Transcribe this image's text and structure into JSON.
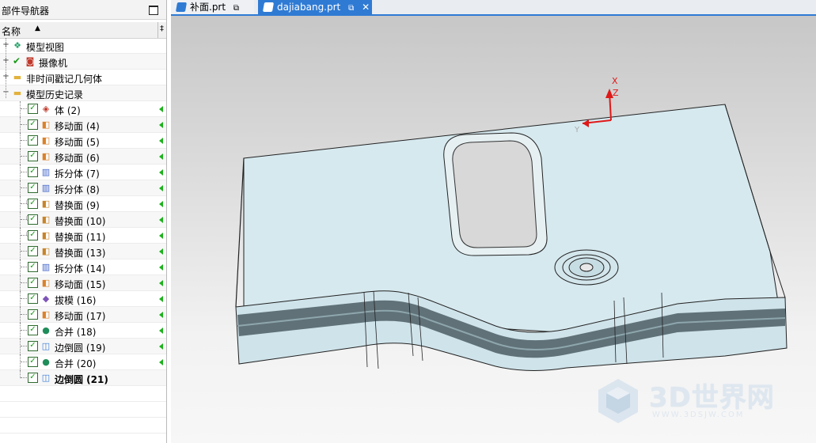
{
  "nav": {
    "title": "部件导航器",
    "column_name": "名称",
    "column_extra": "‡",
    "top_items": [
      {
        "label": "模型视图",
        "icon": "model-views-icon"
      },
      {
        "label": "摄像机",
        "icon": "camera-icon"
      },
      {
        "label": "非时间戳记几何体",
        "icon": "folder-icon"
      },
      {
        "label": "模型历史记录",
        "icon": "folder-open-icon"
      }
    ],
    "history": [
      {
        "label": "体 (2)",
        "icon": "body-icon",
        "info": false,
        "bold": false
      },
      {
        "label": "移动面 (4)",
        "icon": "move-face-icon",
        "info": false,
        "bold": false
      },
      {
        "label": "移动面 (5)",
        "icon": "move-face-icon",
        "info": false,
        "bold": false
      },
      {
        "label": "移动面 (6)",
        "icon": "move-face-icon",
        "info": false,
        "bold": false
      },
      {
        "label": "拆分体 (7)",
        "icon": "split-body-icon",
        "info": false,
        "bold": false
      },
      {
        "label": "拆分体 (8)",
        "icon": "split-body-icon",
        "info": false,
        "bold": false
      },
      {
        "label": "替换面 (9)",
        "icon": "replace-face-icon",
        "info": true,
        "bold": false
      },
      {
        "label": "替换面 (10)",
        "icon": "replace-face-icon",
        "info": true,
        "bold": false
      },
      {
        "label": "替换面 (11)",
        "icon": "replace-face-icon",
        "info": true,
        "bold": false
      },
      {
        "label": "替换面 (13)",
        "icon": "replace-face-icon",
        "info": false,
        "bold": false
      },
      {
        "label": "拆分体 (14)",
        "icon": "split-body-icon",
        "info": false,
        "bold": false
      },
      {
        "label": "移动面 (15)",
        "icon": "move-face-icon",
        "info": false,
        "bold": false
      },
      {
        "label": "拔模 (16)",
        "icon": "draft-icon",
        "info": false,
        "bold": false
      },
      {
        "label": "移动面 (17)",
        "icon": "move-face-icon",
        "info": false,
        "bold": false
      },
      {
        "label": "合并 (18)",
        "icon": "unite-icon",
        "info": false,
        "bold": false
      },
      {
        "label": "边倒圆 (19)",
        "icon": "edge-blend-icon",
        "info": false,
        "bold": false
      },
      {
        "label": "合并 (20)",
        "icon": "unite-icon",
        "info": false,
        "bold": false
      },
      {
        "label": "边倒圆 (21)",
        "icon": "edge-blend-icon",
        "info": false,
        "bold": true
      }
    ]
  },
  "tabs": [
    {
      "label": "补面.prt",
      "active": false,
      "ext_icon": "external-icon"
    },
    {
      "label": "dajiabang.prt",
      "active": true,
      "ext_icon": "external-icon",
      "close": "✕"
    }
  ],
  "viewport": {
    "axis_labels": {
      "x": "X",
      "y": "Y",
      "z": "Z"
    },
    "colors": {
      "part_fill": "#cfe3ea",
      "accent": "#2f7bd4",
      "axis_red": "#e01818"
    }
  },
  "watermark": {
    "text": "3D世界网",
    "url": "WWW.3DSJW.COM"
  }
}
